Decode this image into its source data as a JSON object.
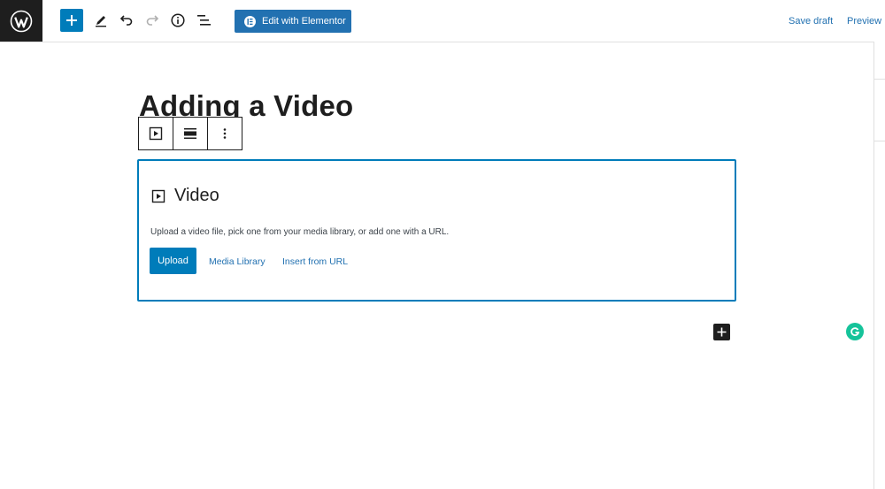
{
  "header": {
    "elementor_label": "Edit with Elementor",
    "save_draft_label": "Save draft",
    "preview_label": "Preview"
  },
  "post": {
    "title": "Adding a Video"
  },
  "video_block": {
    "title": "Video",
    "description": "Upload a video file, pick one from your media library, or add one with a URL.",
    "upload_label": "Upload",
    "media_library_label": "Media Library",
    "insert_url_label": "Insert from URL"
  },
  "colors": {
    "accent": "#007cba",
    "link": "#2271b1",
    "dark": "#1e1e1e",
    "grammarly": "#15c39a"
  }
}
